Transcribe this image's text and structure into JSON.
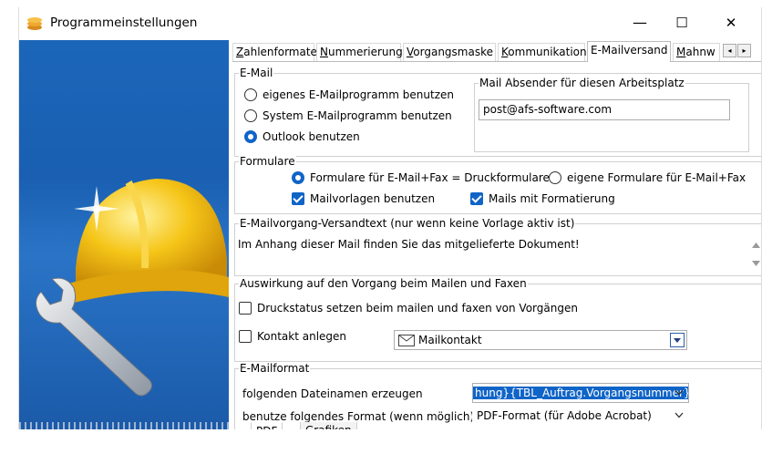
{
  "window": {
    "title": "Programmeinstellungen",
    "minimize": "—",
    "maximize": "☐",
    "close": "✕"
  },
  "tabs": [
    {
      "label": "Zahlenformate",
      "ul": "Z"
    },
    {
      "label": "Nummerierung",
      "ul": "N"
    },
    {
      "label": "Vorgangsmaske",
      "ul": "V"
    },
    {
      "label": "Kommunikation",
      "ul": "K"
    },
    {
      "label": "E-Mailversand",
      "ul": ""
    },
    {
      "label": "Mahnw",
      "ul": "M"
    }
  ],
  "tab_scroll": {
    "left": "◂",
    "right": "▸"
  },
  "email": {
    "legend": "E-Mail",
    "opt_own": "eigenes E-Mailprogramm benutzen",
    "opt_system": "System E-Mailprogramm benutzen",
    "opt_outlook": "Outlook benutzen",
    "sender_legend": "Mail Absender für diesen Arbeitsplatz",
    "sender_value": "post@afs-software.com"
  },
  "formulare": {
    "legend": "Formulare",
    "opt_print": "Formulare für E-Mail+Fax = Druckformulare",
    "opt_own": "eigene Formulare für E-Mail+Fax",
    "chk_templates": "Mailvorlagen benutzen",
    "chk_format": "Mails mit Formatierung"
  },
  "versandtext": {
    "legend": "E-Mailvorgang-Versandtext (nur wenn keine Vorlage aktiv ist)",
    "text": "Im Anhang dieser Mail finden Sie das mitgelieferte Dokument!"
  },
  "auswirkung": {
    "legend": "Auswirkung auf den Vorgang beim Mailen und Faxen",
    "chk_print": "Druckstatus setzen beim mailen und faxen von Vorgängen",
    "chk_contact": "Kontakt anlegen",
    "contact_value": "Mailkontakt"
  },
  "mailformat": {
    "legend": "E-Mailformat",
    "filename_label": "folgenden Dateinamen erzeugen",
    "filename_value": "hung}{TBL_Auftrag.Vorgangsnummer}",
    "format_label": "benutze folgendes Format (wenn möglich)",
    "format_value": "PDF-Format (für Adobe Acrobat)"
  },
  "bottom_tabs": [
    "PDF",
    "Grafiken"
  ],
  "colors": {
    "accent": "#0f64c7",
    "leftpane": "#1b62b4"
  }
}
